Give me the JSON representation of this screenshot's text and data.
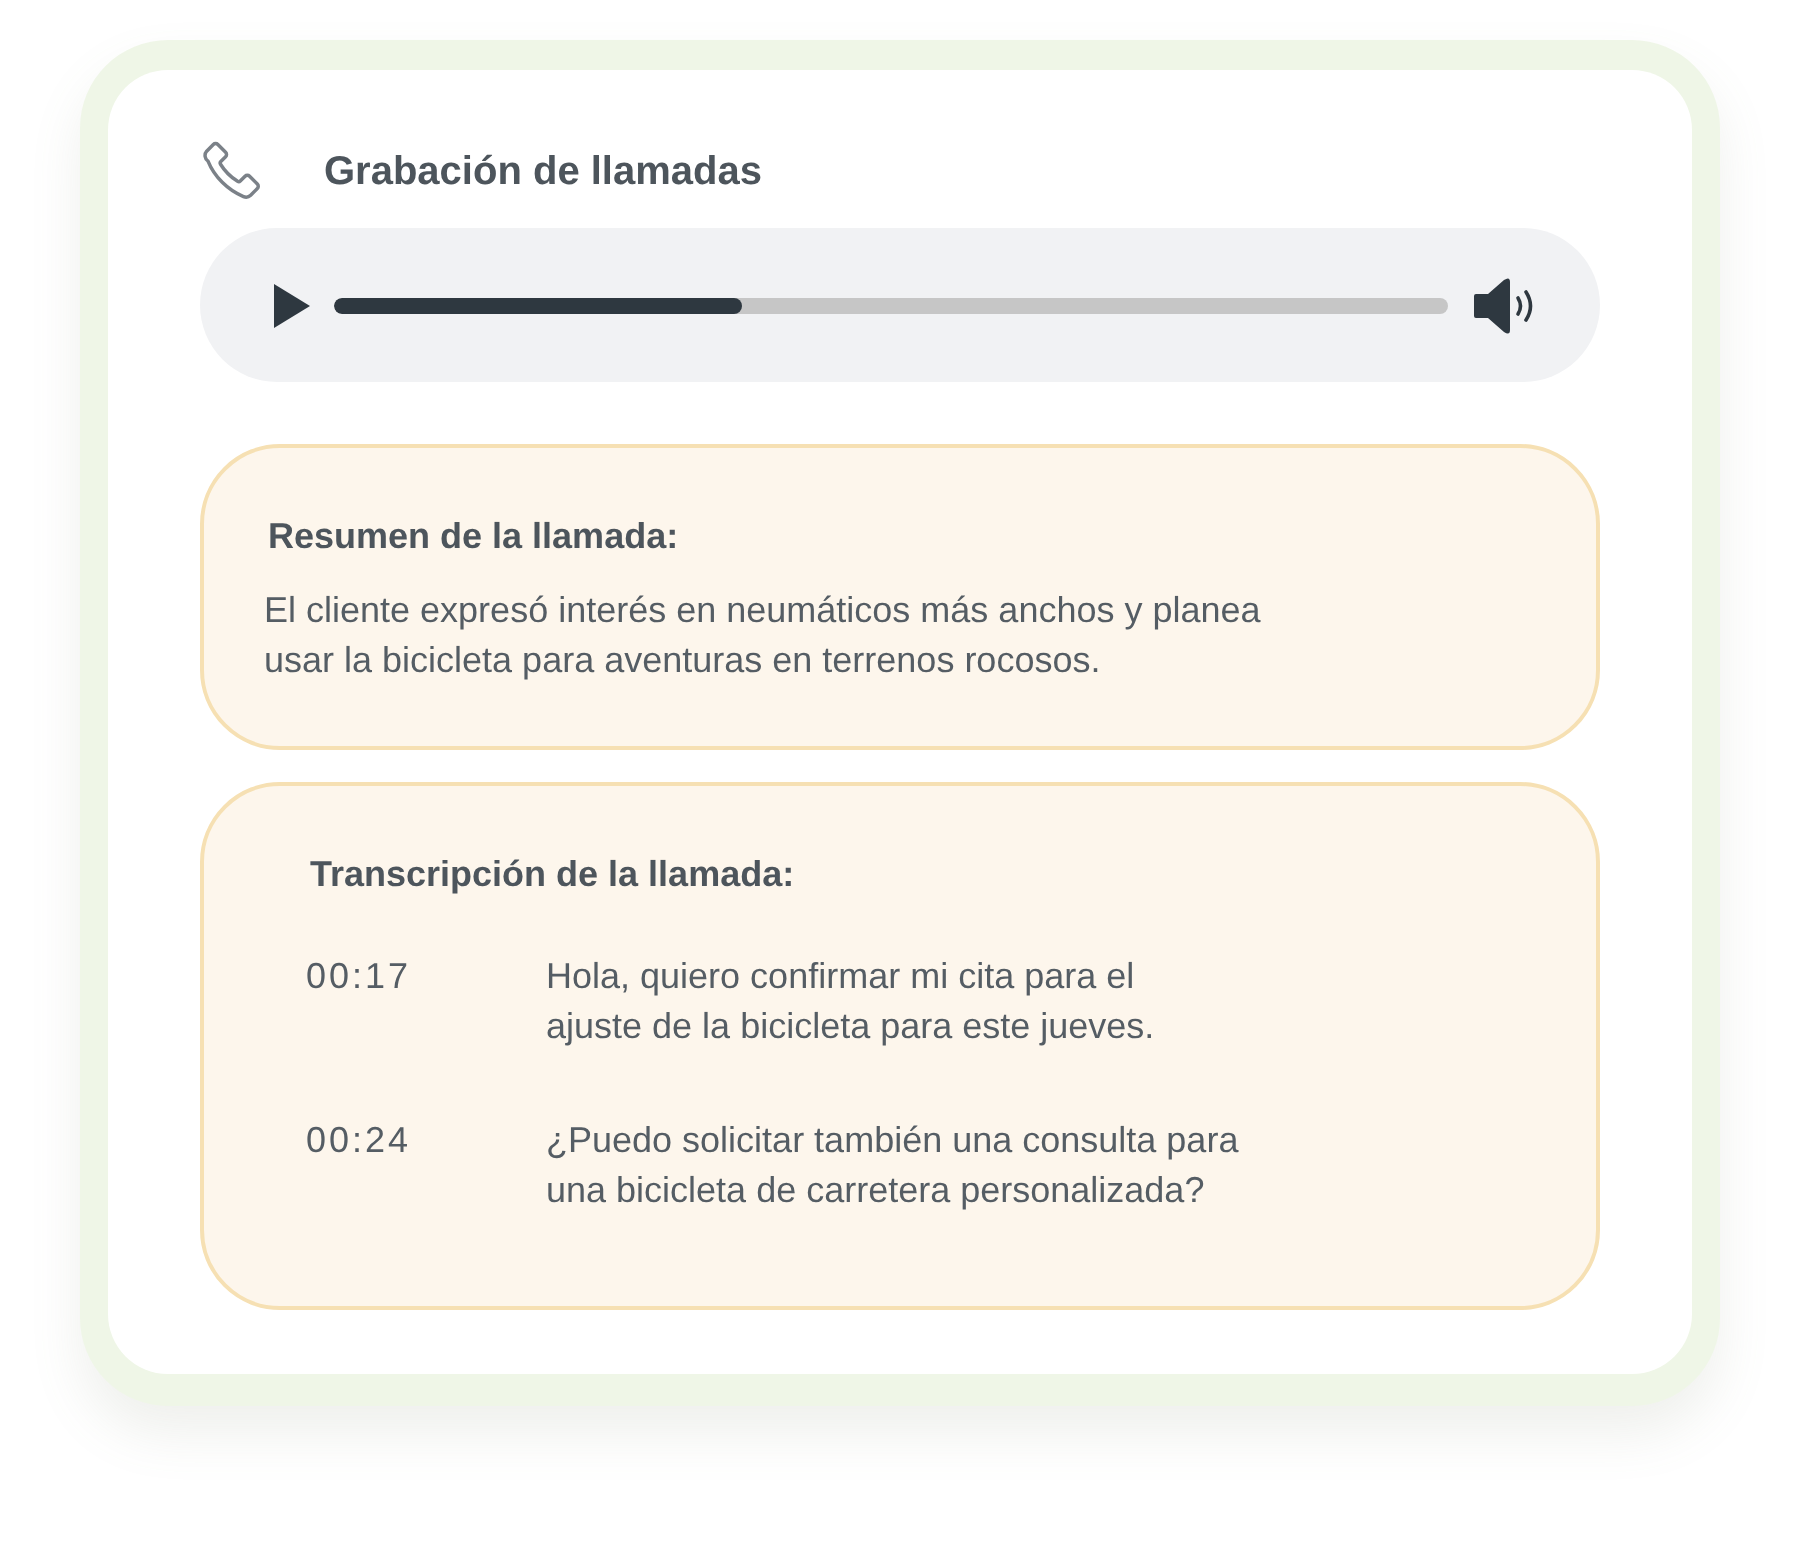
{
  "header": {
    "title": "Grabación de llamadas"
  },
  "player": {
    "level": 0.366
  },
  "summary": {
    "heading": "Resumen de la llamada:",
    "text": "El cliente expresó interés en neumáticos más anchos y planea\nusar la bicicleta para aventuras en terrenos rocosos."
  },
  "transcript": {
    "heading": "Transcripción de la llamada:",
    "entries": [
      {
        "time": "00:17",
        "text": "Hola, quiero confirmar mi cita para el\najuste de la bicicleta para este jueves."
      },
      {
        "time": "00:24",
        "text": "¿Puedo solicitar también una consulta para\nuna bicicleta de carretera personalizada?"
      }
    ]
  }
}
